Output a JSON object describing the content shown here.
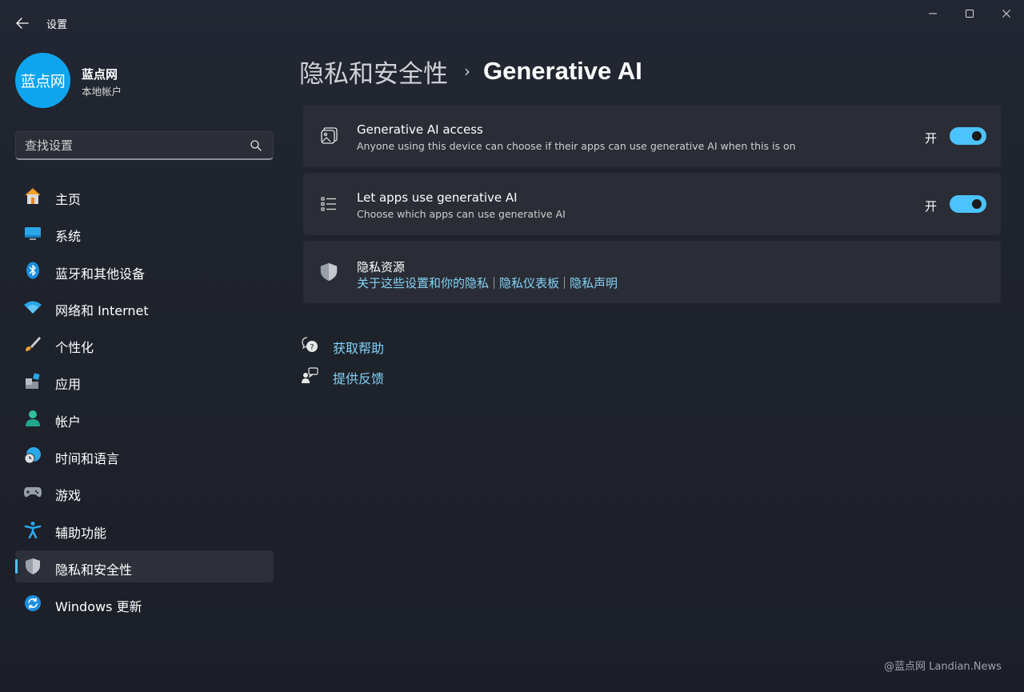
{
  "window": {
    "title": "设置",
    "controls": {
      "minimize": "minimize-icon",
      "maximize": "maximize-icon",
      "close": "close-icon"
    }
  },
  "profile": {
    "avatar_text": "蓝点网",
    "name": "蓝点网",
    "account_type": "本地帐户"
  },
  "search": {
    "placeholder": "查找设置",
    "value": ""
  },
  "sidebar": {
    "items": [
      {
        "label": "主页",
        "icon": "home-icon"
      },
      {
        "label": "系统",
        "icon": "system-monitor-icon"
      },
      {
        "label": "蓝牙和其他设备",
        "icon": "bluetooth-icon"
      },
      {
        "label": "网络和 Internet",
        "icon": "wifi-icon"
      },
      {
        "label": "个性化",
        "icon": "brush-icon"
      },
      {
        "label": "应用",
        "icon": "apps-icon"
      },
      {
        "label": "帐户",
        "icon": "account-icon"
      },
      {
        "label": "时间和语言",
        "icon": "globe-clock-icon"
      },
      {
        "label": "游戏",
        "icon": "gamepad-icon"
      },
      {
        "label": "辅助功能",
        "icon": "accessibility-icon"
      },
      {
        "label": "隐私和安全性",
        "icon": "shield-icon",
        "active": true
      },
      {
        "label": "Windows 更新",
        "icon": "update-icon"
      }
    ]
  },
  "breadcrumb": {
    "parent": "隐私和安全性",
    "separator": "›",
    "current": "Generative AI"
  },
  "settings": {
    "ai_access": {
      "title": "Generative AI access",
      "description": "Anyone using this device can choose if their apps can use generative AI when this is on",
      "state_label": "开",
      "on": true
    },
    "apps_use_ai": {
      "title": "Let apps use generative AI",
      "description": "Choose which apps can use generative AI",
      "state_label": "开",
      "on": true
    },
    "privacy_resources": {
      "title": "隐私资源",
      "links": [
        "关于这些设置和你的隐私",
        "隐私仪表板",
        "隐私声明"
      ]
    }
  },
  "help": {
    "get_help": "获取帮助",
    "feedback": "提供反馈"
  },
  "watermark": "@蓝点网 Landian.News",
  "colors": {
    "accent": "#4cc2ff",
    "link": "#84d2f6",
    "card": "#2a2d35",
    "background": "#1f232c"
  }
}
